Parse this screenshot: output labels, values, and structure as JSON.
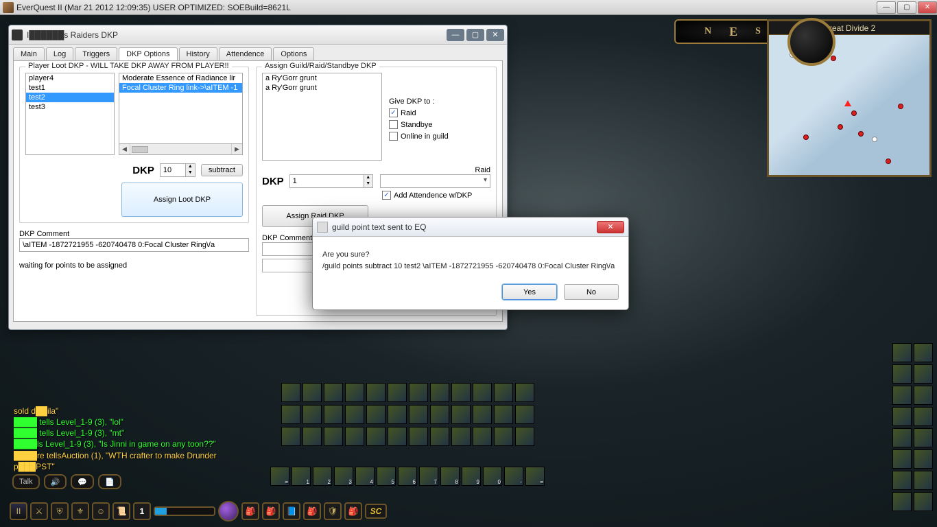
{
  "os_title": "EverQuest II (Mar 21 2012 12:09:35) USER OPTIMIZED: SOEBuild=8621L",
  "os_controls": {
    "min": "—",
    "max": "▢",
    "close": "✕"
  },
  "app": {
    "title": "I██████s Raiders DKP",
    "tabs": [
      "Main",
      "Log",
      "Triggers",
      "DKP Options",
      "History",
      "Attendence",
      "Options"
    ],
    "active_tab": "DKP Options",
    "left": {
      "legend": "Player Loot DKP - WILL TAKE DKP AWAY FROM PLAYER!!",
      "players": [
        "player4",
        "test1",
        "test2",
        "test3"
      ],
      "players_selected": "test2",
      "items": [
        "Moderate Essence of Radiance lir",
        "Focal Cluster Ring link->\\aITEM -1"
      ],
      "items_selected_index": 1,
      "dkp_label": "DKP",
      "dkp_value": "10",
      "subtract": "subtract",
      "assign_button": "Assign Loot DKP",
      "comment_label": "DKP Comment",
      "comment_value": "\\aITEM -1872721955 -620740478 0:Focal Cluster Ring\\/a",
      "status": "waiting for points to be assigned"
    },
    "right": {
      "legend": "Assign Guild/Raid/Standbye DKP",
      "mobs": [
        "a Ry'Gorr grunt",
        "a Ry'Gorr grunt"
      ],
      "give_label": "Give DKP to :",
      "checks": {
        "raid": "Raid",
        "standby": "Standbye",
        "online": "Online in guild"
      },
      "raid_dd_label": "Raid",
      "dkp_label": "DKP",
      "dkp_value": "1",
      "add_attendance": "Add Attendence w/DKP",
      "assign_button": "Assign Raid DKP",
      "comment_label": "DKP Comment:"
    }
  },
  "dialog": {
    "title": "guild point text sent to EQ",
    "line1": "Are you sure?",
    "line2": "/guild points subtract 10 test2 \\aITEM -1872721955 -620740478 0:Focal Cluster Ring\\/a",
    "yes": "Yes",
    "no": "No"
  },
  "compass": {
    "n": "N",
    "e": "E",
    "s": "S"
  },
  "minimap": {
    "title": "Great Divide 2"
  },
  "chat": {
    "l0": "sold d██ila\"",
    "l1": "████ tells Level_1-9 (3), \"lol\"",
    "l2": "████ tells Level_1-9 (3), \"mt\"",
    "l3": "████ls Level_1-9 (3), \"Is Jinni in game on any toon??\"",
    "l4": "████re tellsAuction (1), \"WTH crafter to make Drunder",
    "l5": "p███PST\""
  },
  "chat_buttons": {
    "talk": "Talk",
    "vol": "🔊",
    "chat": "💬",
    "page": "📄"
  },
  "bottombar": {
    "one": "1",
    "sc": "SC"
  }
}
